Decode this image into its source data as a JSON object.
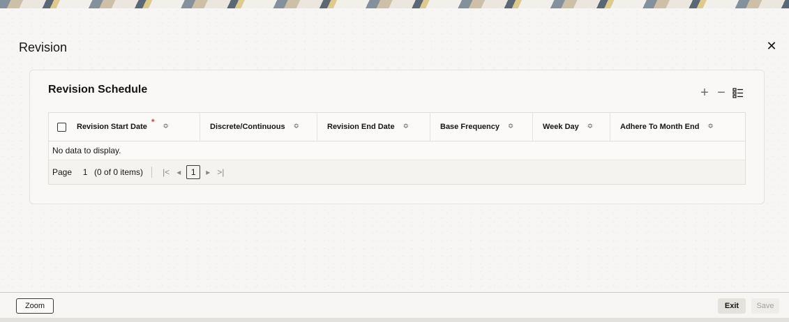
{
  "window": {
    "title": "Revision",
    "close_icon": "close-icon"
  },
  "section": {
    "title": "Revision Schedule",
    "tools": {
      "add_icon": "plus-icon",
      "remove_icon": "minus-icon",
      "columns_icon": "list-settings-icon"
    }
  },
  "table": {
    "columns": [
      {
        "label": "Revision Start Date",
        "required": true
      },
      {
        "label": "Discrete/Continuous",
        "required": false
      },
      {
        "label": "Revision End Date",
        "required": false
      },
      {
        "label": "Base Frequency",
        "required": false
      },
      {
        "label": "Week Day",
        "required": false
      },
      {
        "label": "Adhere To Month End",
        "required": false
      }
    ],
    "required_marker": "*",
    "sort_glyph": "≎",
    "empty_message": "No data to display."
  },
  "pager": {
    "label": "Page",
    "page_value": "1",
    "item_summary": "(0 of 0 items)",
    "first_glyph": "|<",
    "prev_glyph": "◂",
    "current_page": "1",
    "next_glyph": "▸",
    "last_glyph": ">|"
  },
  "footer": {
    "zoom_label": "Zoom",
    "exit_label": "Exit",
    "save_label": "Save"
  }
}
